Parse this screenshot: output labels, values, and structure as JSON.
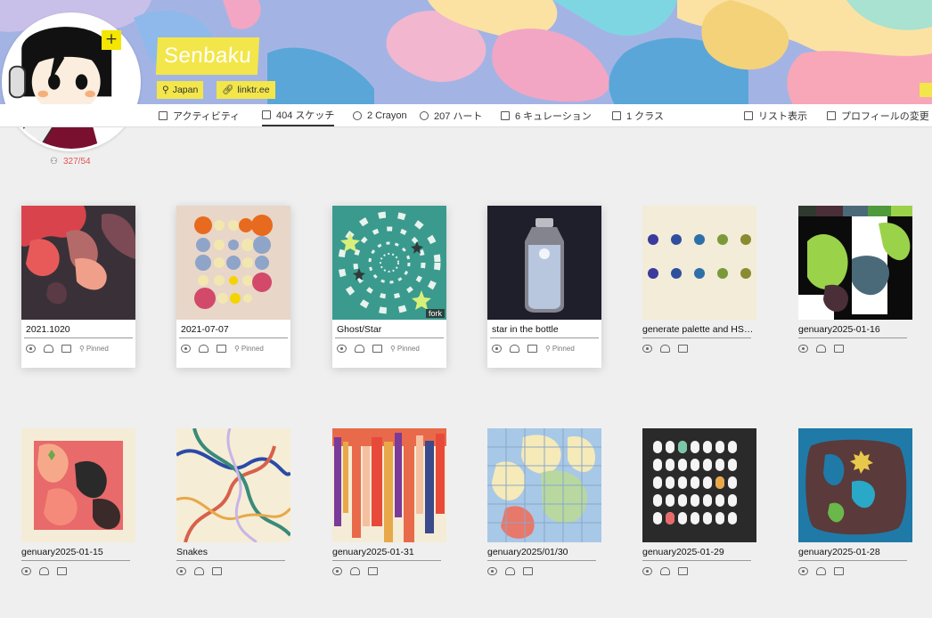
{
  "profile": {
    "username": "Senbaku",
    "location": "Japan",
    "link": "linktr.ee",
    "followers": "327/54",
    "avatar_edit_glyph": "+"
  },
  "nav": {
    "activity": "アクティビティ",
    "sketches": "404 スケッチ",
    "crayon": "2 Crayon",
    "hearts": "207 ハート",
    "curations": "6 キュレーション",
    "classes": "1 クラス",
    "list_view": "リスト表示",
    "edit_profile": "プロフィールの変更"
  },
  "pinned_label": "Pinned",
  "fork_label": "fork",
  "sketches": [
    {
      "title": "2021.1020",
      "pinned": true,
      "icon": "dark-blob-art"
    },
    {
      "title": "2021-07-07",
      "pinned": true,
      "icon": "circle-grid-art"
    },
    {
      "title": "Ghost/Star",
      "pinned": true,
      "fork": true,
      "icon": "ghost-spiral-art"
    },
    {
      "title": "star in the bottle",
      "pinned": true,
      "icon": "bottle-art"
    },
    {
      "title": "generate palette and HSB t...",
      "pinned": false,
      "icon": "palette-art"
    },
    {
      "title": "genuary2025-01-16",
      "pinned": false,
      "icon": "green-blob-art"
    },
    {
      "title": "genuary2025-01-15",
      "pinned": false,
      "icon": "red-blob-art"
    },
    {
      "title": "Snakes",
      "pinned": false,
      "icon": "snakes-art"
    },
    {
      "title": "genuary2025-01-31",
      "pinned": false,
      "icon": "drips-art"
    },
    {
      "title": "genuary2025/01/30",
      "pinned": false,
      "icon": "grid-blobs-art"
    },
    {
      "title": "genuary2025-01-29",
      "pinned": false,
      "icon": "ghost-grid-art"
    },
    {
      "title": "genuary2025-01-28",
      "pinned": false,
      "icon": "blue-blob-art"
    }
  ],
  "colors": {
    "accent": "#f2e64a",
    "follower_count": "#e05555"
  }
}
